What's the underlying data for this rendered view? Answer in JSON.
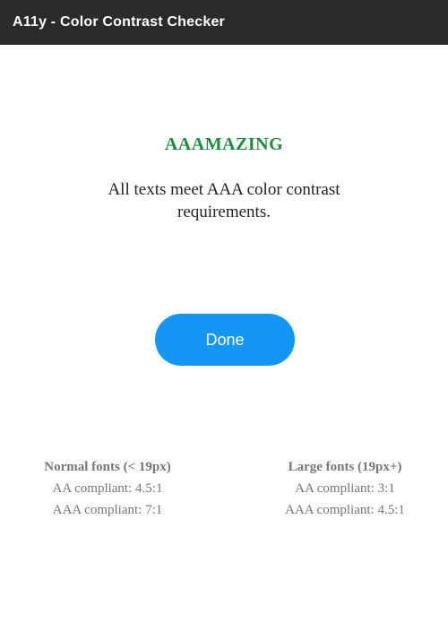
{
  "window": {
    "title": "A11y - Color Contrast Checker"
  },
  "result": {
    "heading": "AAAMAZING",
    "message": "All texts meet AAA color contrast requirements.",
    "heading_color": "#1a8f3a"
  },
  "actions": {
    "done_label": "Done",
    "done_color": "#1496f4"
  },
  "legend": {
    "normal": {
      "title": "Normal fonts (< 19px)",
      "aa": "AA compliant: 4.5:1",
      "aaa": "AAA compliant: 7:1"
    },
    "large": {
      "title": "Large fonts (19px+)",
      "aa": "AA compliant: 3:1",
      "aaa": "AAA compliant: 4.5:1"
    }
  }
}
